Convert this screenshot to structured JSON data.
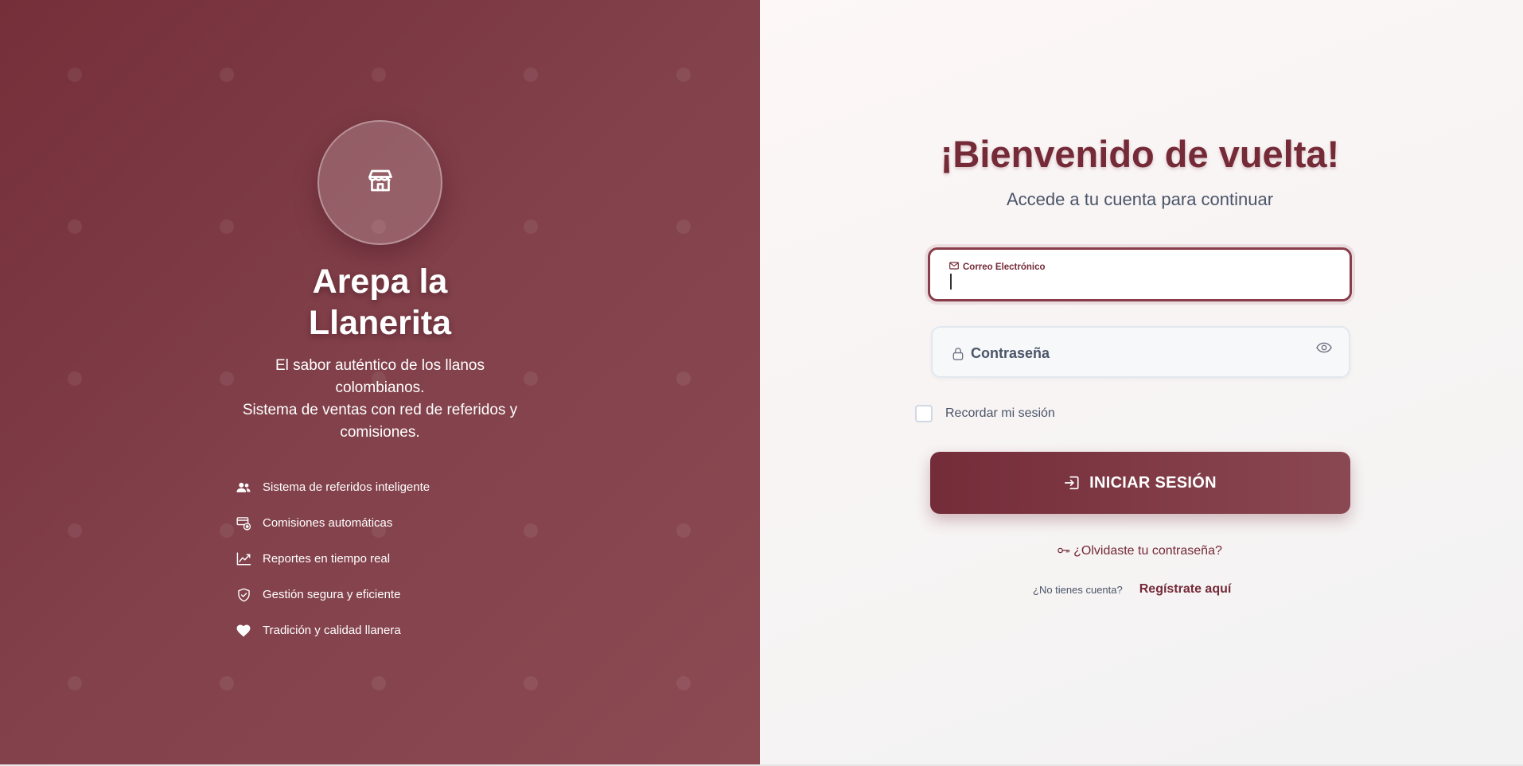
{
  "brand": {
    "name": "Arepa la Llanerita",
    "description_line1": "El sabor auténtico de los llanos colombianos.",
    "description_line2": "Sistema de ventas con red de referidos y comisiones.",
    "icon": "store-icon"
  },
  "features": [
    {
      "label": "Sistema de referidos inteligente",
      "icon": "users-icon"
    },
    {
      "label": "Comisiones automáticas",
      "icon": "commission-icon"
    },
    {
      "label": "Reportes en tiempo real",
      "icon": "chart-line-icon"
    },
    {
      "label": "Gestión segura y eficiente",
      "icon": "shield-check-icon"
    },
    {
      "label": "Tradición y calidad llanera",
      "icon": "heart-icon"
    }
  ],
  "login": {
    "title": "¡Bienvenido de vuelta!",
    "subtitle": "Accede a tu cuenta para continuar",
    "email_label": "Correo Electrónico",
    "email_value": "",
    "password_placeholder": "Contraseña",
    "remember_label": "Recordar mi sesión",
    "submit_label": "INICIAR SESIÓN",
    "forgot_label": "¿Olvidaste tu contraseña?",
    "no_account_label": "¿No tienes cuenta?",
    "signup_label": "Regístrate aquí"
  },
  "colors": {
    "brand": "#742a37",
    "panel": "#82414b",
    "text_muted": "#4a5568"
  }
}
